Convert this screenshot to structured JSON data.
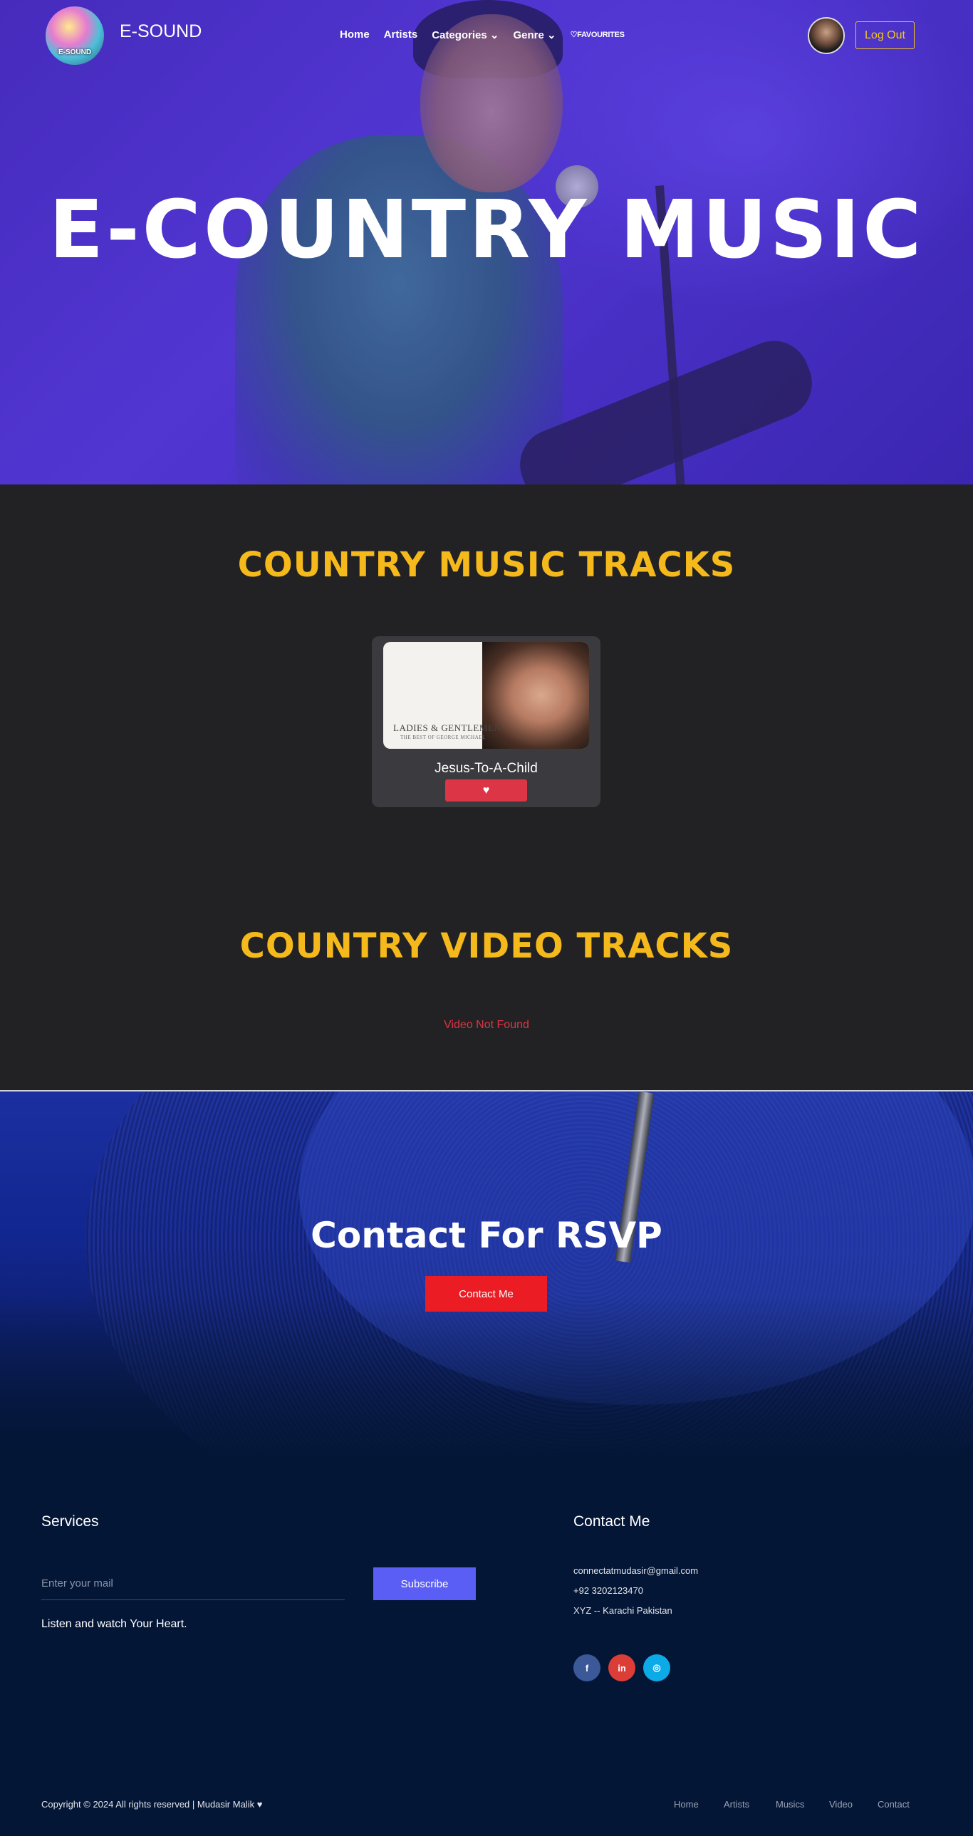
{
  "nav": {
    "brand": "E-SOUND",
    "logo_text": "E-SOUND",
    "links": [
      "Home",
      "Artists",
      "Categories",
      "Genre",
      "FAVOURITES"
    ],
    "logout_label": "Log Out"
  },
  "hero": {
    "title": "E-COUNTRY MUSIC"
  },
  "music": {
    "title": "COUNTRY MUSIC TRACKS",
    "tracks": [
      {
        "name": "Jesus-To-A-Child",
        "cover_title": "LADIES & GENTLEMEN",
        "cover_sub": "THE BEST OF GEORGE MICHAEL"
      }
    ]
  },
  "video": {
    "title": "COUNTRY VIDEO TRACKS",
    "empty_message": "Video Not Found"
  },
  "contact_banner": {
    "title": "Contact For RSVP",
    "button_label": "Contact Me"
  },
  "footer": {
    "services_heading": "Services",
    "email_placeholder": "Enter your mail",
    "subscribe_label": "Subscribe",
    "tagline": "Listen and watch Your Heart.",
    "contact_heading": "Contact Me",
    "email": "connectatmudasir@gmail.com",
    "phone": "+92 3202123470",
    "address": "XYZ -- Karachi Pakistan",
    "social": [
      {
        "icon": "facebook-icon",
        "glyph": "f",
        "color": "#3b5998"
      },
      {
        "icon": "linkedin-icon",
        "glyph": "in",
        "color": "#dc3e37"
      },
      {
        "icon": "instagram-icon",
        "glyph": "◎",
        "color": "#0daae8"
      }
    ],
    "copyright": "Copyright © 2024 All rights reserved | Mudasir Malik ♥",
    "links": [
      "Home",
      "Artists",
      "Musics",
      "Video",
      "Contact"
    ]
  },
  "colors": {
    "accent": "#f5b91c",
    "danger": "#dc3545",
    "cta": "#ec1c24",
    "subscribe": "#5b5ef4"
  }
}
